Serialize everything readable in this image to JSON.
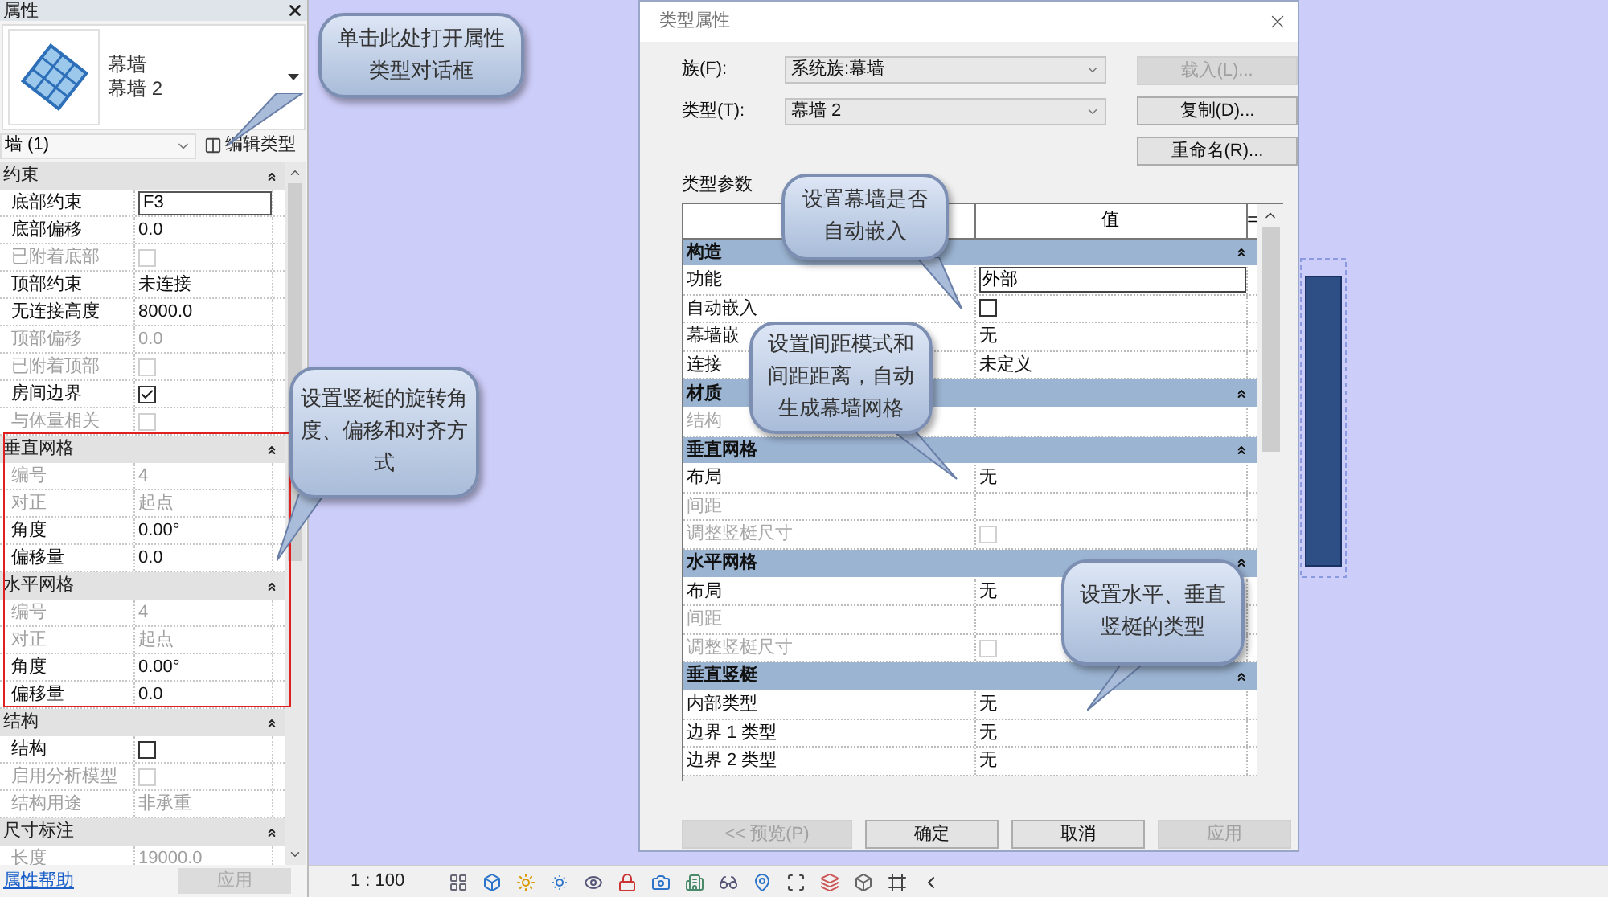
{
  "properties_panel": {
    "title": "属性",
    "type_family": "幕墙",
    "type_name": "幕墙 2",
    "instance_filter": "墙 (1)",
    "edit_type": "编辑类型",
    "groups": [
      {
        "name": "约束",
        "rows": [
          {
            "label": "底部约束",
            "value": "F3",
            "kind": "field",
            "disabled": false
          },
          {
            "label": "底部偏移",
            "value": "0.0",
            "kind": "text",
            "disabled": false
          },
          {
            "label": "已附着底部",
            "kind": "checkbox",
            "checked": false,
            "disabled": true
          },
          {
            "label": "顶部约束",
            "value": "未连接",
            "kind": "text",
            "disabled": false
          },
          {
            "label": "无连接高度",
            "value": "8000.0",
            "kind": "text",
            "disabled": false
          },
          {
            "label": "顶部偏移",
            "value": "0.0",
            "kind": "text",
            "disabled": true
          },
          {
            "label": "已附着顶部",
            "kind": "checkbox",
            "checked": false,
            "disabled": true
          },
          {
            "label": "房间边界",
            "kind": "checkbox",
            "checked": true,
            "disabled": false
          },
          {
            "label": "与体量相关",
            "kind": "checkbox",
            "checked": false,
            "disabled": true
          }
        ]
      },
      {
        "name": "垂直网格",
        "rows": [
          {
            "label": "编号",
            "value": "4",
            "kind": "text",
            "disabled": true
          },
          {
            "label": "对正",
            "value": "起点",
            "kind": "text",
            "disabled": true
          },
          {
            "label": "角度",
            "value": "0.00°",
            "kind": "text",
            "disabled": false
          },
          {
            "label": "偏移量",
            "value": "0.0",
            "kind": "text",
            "disabled": false
          }
        ]
      },
      {
        "name": "水平网格",
        "rows": [
          {
            "label": "编号",
            "value": "4",
            "kind": "text",
            "disabled": true
          },
          {
            "label": "对正",
            "value": "起点",
            "kind": "text",
            "disabled": true
          },
          {
            "label": "角度",
            "value": "0.00°",
            "kind": "text",
            "disabled": false
          },
          {
            "label": "偏移量",
            "value": "0.0",
            "kind": "text",
            "disabled": false
          }
        ]
      },
      {
        "name": "结构",
        "rows": [
          {
            "label": "结构",
            "kind": "checkbox",
            "checked": false,
            "disabled": false
          },
          {
            "label": "启用分析模型",
            "kind": "checkbox",
            "checked": false,
            "disabled": true
          },
          {
            "label": "结构用途",
            "value": "非承重",
            "kind": "text",
            "disabled": true
          }
        ]
      },
      {
        "name": "尺寸标注",
        "rows": [
          {
            "label": "长度",
            "value": "19000.0",
            "kind": "text",
            "disabled": true
          }
        ]
      }
    ],
    "help_link": "属性帮助",
    "apply": {
      "label": "应用",
      "disabled": true
    }
  },
  "status_bar": {
    "scale": "1 : 100"
  },
  "dialog": {
    "title": "类型属性",
    "family_label": "族(F):",
    "family_value": "系统族:幕墙",
    "type_label": "类型(T):",
    "type_value": "幕墙 2",
    "side_buttons": [
      {
        "label": "载入(L)...",
        "disabled": true
      },
      {
        "label": "复制(D)...",
        "disabled": false
      },
      {
        "label": "重命名(R)...",
        "disabled": false
      }
    ],
    "params_label": "类型参数",
    "value_header": "值",
    "equals_header": "=",
    "groups": [
      {
        "name": "构造",
        "rows": [
          {
            "label": "功能",
            "value": "外部",
            "kind": "field",
            "disabled": false
          },
          {
            "label": "自动嵌入",
            "kind": "checkbox",
            "checked": false,
            "disabled": false
          },
          {
            "label": "幕墙嵌",
            "value": "无",
            "kind": "text",
            "disabled": false
          },
          {
            "label": "连接",
            "value": "未定义",
            "kind": "text",
            "disabled": false
          }
        ]
      },
      {
        "name": "材质",
        "rows": [
          {
            "label": "结构",
            "kind": "text",
            "disabled": true
          }
        ]
      },
      {
        "name": "垂直网格",
        "rows": [
          {
            "label": "布局",
            "value": "无",
            "kind": "text",
            "disabled": false
          },
          {
            "label": "间距",
            "kind": "text",
            "disabled": true
          },
          {
            "label": "调整竖梃尺寸",
            "kind": "checkbox",
            "checked": false,
            "disabled": true
          }
        ]
      },
      {
        "name": "水平网格",
        "rows": [
          {
            "label": "布局",
            "value": "无",
            "kind": "text",
            "disabled": false
          },
          {
            "label": "间距",
            "kind": "text",
            "disabled": true
          },
          {
            "label": "调整竖梃尺寸",
            "kind": "checkbox",
            "checked": false,
            "disabled": true
          }
        ]
      },
      {
        "name": "垂直竖梃",
        "rows": [
          {
            "label": "内部类型",
            "value": "无",
            "kind": "text",
            "disabled": false
          },
          {
            "label": "边界 1 类型",
            "value": "无",
            "kind": "text",
            "disabled": false
          },
          {
            "label": "边界 2 类型",
            "value": "无",
            "kind": "text",
            "disabled": false
          }
        ]
      }
    ],
    "footer_buttons": [
      {
        "label": "<< 预览(P)",
        "disabled": true
      },
      {
        "label": "确定",
        "disabled": false
      },
      {
        "label": "取消",
        "disabled": false
      },
      {
        "label": "应用",
        "disabled": true
      }
    ]
  },
  "callouts": [
    {
      "text": "单击此处打开属性类型对话框"
    },
    {
      "text": "设置竖梃的旋转角度、偏移和对齐方式"
    },
    {
      "text": "设置幕墙是否自动嵌入"
    },
    {
      "text": "设置间距模式和间距距离，自动生成幕墙网格"
    },
    {
      "text": "设置水平、垂直竖梃的类型"
    }
  ]
}
